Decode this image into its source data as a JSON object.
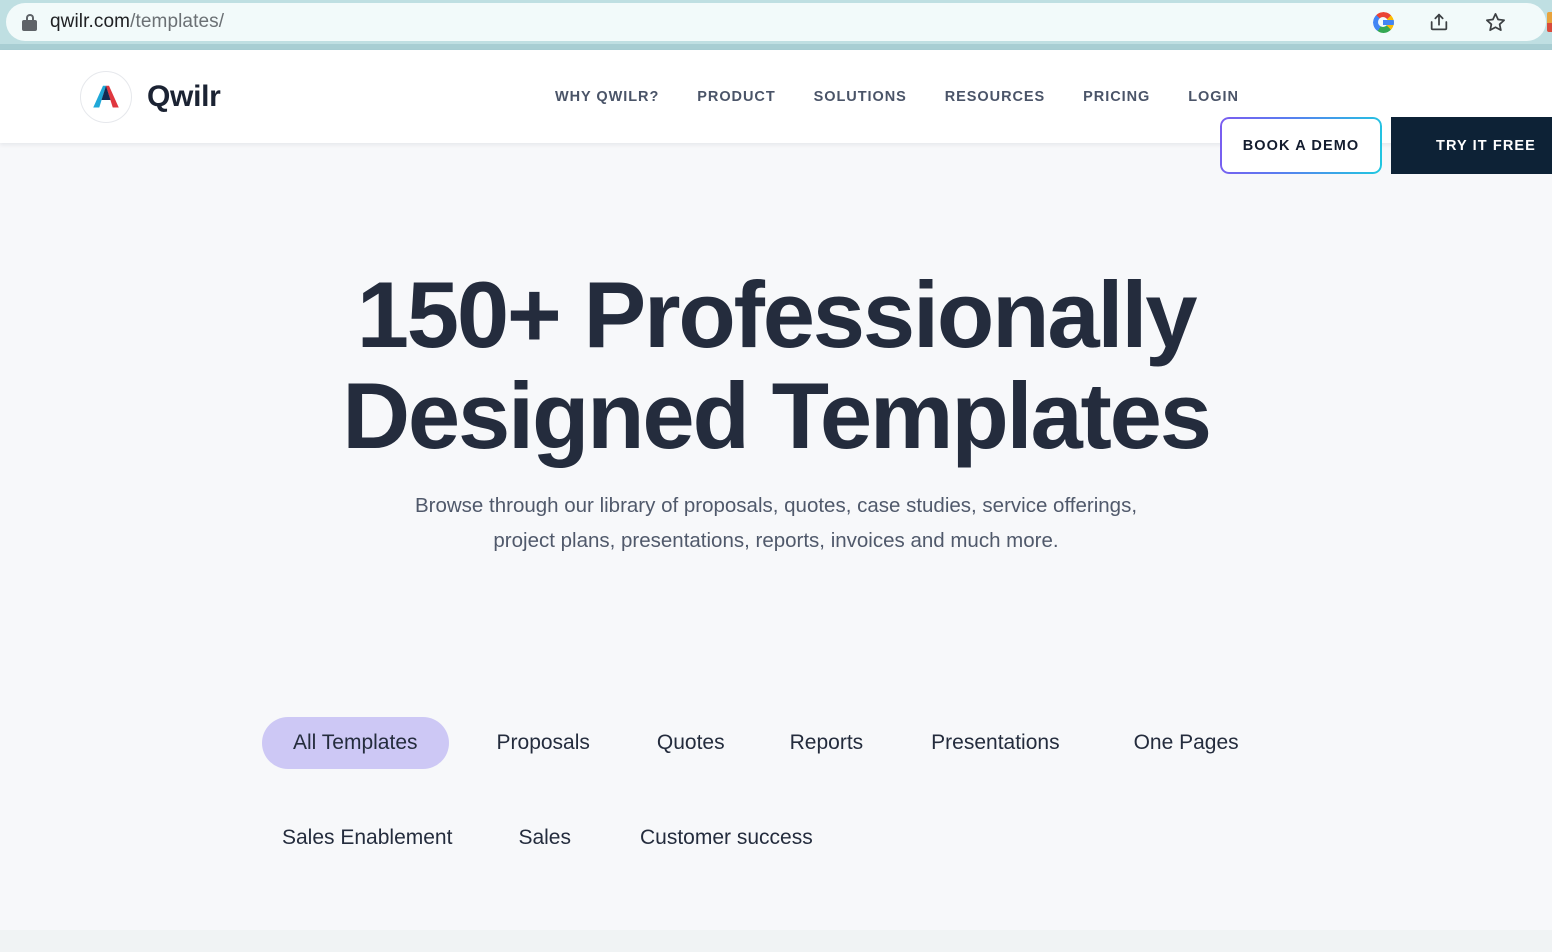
{
  "browser": {
    "lock_icon": "lock-icon",
    "url_domain": "qwilr.com",
    "url_path": "/templates/",
    "actions": [
      {
        "name": "google-icon",
        "label": "G"
      },
      {
        "name": "share-icon",
        "label": "Share"
      },
      {
        "name": "bookmark-star-icon",
        "label": "Bookmark"
      }
    ]
  },
  "header": {
    "logo_wordmark": "Qwilr",
    "nav": [
      {
        "label": "WHY QWILR?",
        "name": "nav-why-qwilr"
      },
      {
        "label": "PRODUCT",
        "name": "nav-product"
      },
      {
        "label": "SOLUTIONS",
        "name": "nav-solutions"
      },
      {
        "label": "RESOURCES",
        "name": "nav-resources"
      },
      {
        "label": "PRICING",
        "name": "nav-pricing"
      },
      {
        "label": "LOGIN",
        "name": "nav-login"
      }
    ],
    "cta_secondary": "BOOK A DEMO",
    "cta_primary": "TRY IT FREE"
  },
  "hero": {
    "title_line1": "150+ Professionally",
    "title_line2": "Designed Templates",
    "subtitle_line1": "Browse through our library of proposals, quotes, case studies, service offerings,",
    "subtitle_line2": "project plans, presentations, reports, invoices and much more."
  },
  "filters": {
    "row1": [
      {
        "label": "All Templates",
        "active": true
      },
      {
        "label": "Proposals",
        "active": false
      },
      {
        "label": "Quotes",
        "active": false
      },
      {
        "label": "Reports",
        "active": false
      },
      {
        "label": "Presentations",
        "active": false
      },
      {
        "label": "One Pages",
        "active": false
      }
    ],
    "row2": [
      {
        "label": "Sales Enablement",
        "active": false
      },
      {
        "label": "Sales",
        "active": false
      },
      {
        "label": "Customer success",
        "active": false
      }
    ]
  },
  "colors": {
    "browser_bar": "#bfdfe2",
    "omnibox": "#f2fafa",
    "hero_bg": "#f7f8fa",
    "heading": "#242c3d",
    "nav_text": "#4a5468",
    "cta_primary_bg": "#0d2236",
    "active_pill": "#cdc8f5",
    "gradient_start": "#7b5cf0",
    "gradient_end": "#1fc8e0"
  }
}
